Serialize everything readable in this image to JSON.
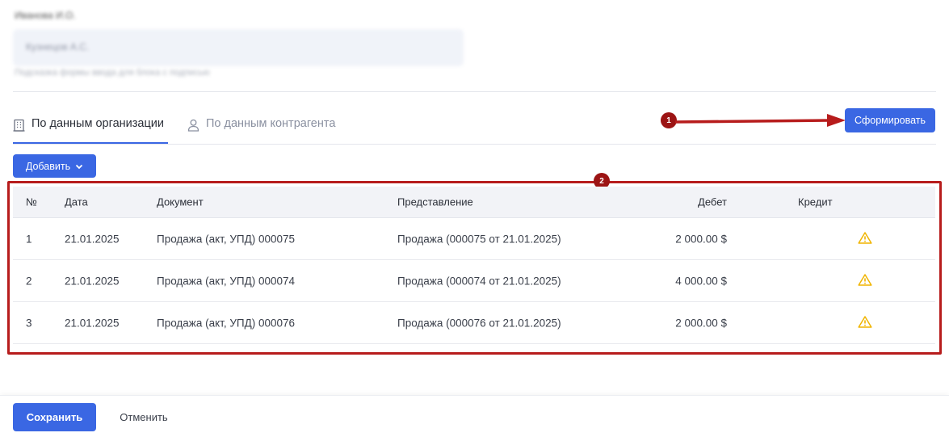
{
  "blurred": {
    "label": "Иванова И.О.",
    "field_value": "Кузнецов А.С.",
    "hint": "Подсказка формы ввода для блока с подписью"
  },
  "tabs": [
    {
      "label": "По данным организации",
      "active": true,
      "icon": "building-icon"
    },
    {
      "label": "По данным контрагента",
      "active": false,
      "icon": "user-icon"
    }
  ],
  "actions": {
    "form_label": "Сформировать",
    "add_label": "Добавить"
  },
  "annotations": {
    "badge1": "1",
    "badge2": "2",
    "color": "#b71c1c"
  },
  "table": {
    "headers": {
      "num": "№",
      "date": "Дата",
      "document": "Документ",
      "representation": "Представление",
      "debit": "Дебет",
      "credit": "Кредит"
    },
    "rows": [
      {
        "num": "1",
        "date": "21.01.2025",
        "document": "Продажа (акт, УПД) 000075",
        "representation": "Продажа (000075 от 21.01.2025)",
        "debit": "2 000.00 $",
        "credit": "",
        "warning": true
      },
      {
        "num": "2",
        "date": "21.01.2025",
        "document": "Продажа (акт, УПД) 000074",
        "representation": "Продажа (000074 от 21.01.2025)",
        "debit": "4 000.00 $",
        "credit": "",
        "warning": true
      },
      {
        "num": "3",
        "date": "21.01.2025",
        "document": "Продажа (акт, УПД) 000076",
        "representation": "Продажа (000076 от 21.01.2025)",
        "debit": "2 000.00 $",
        "credit": "",
        "warning": true
      }
    ]
  },
  "footer": {
    "save_label": "Сохранить",
    "cancel_label": "Отменить"
  },
  "colors": {
    "accent": "#3a67e3",
    "warning": "#f0b400"
  }
}
